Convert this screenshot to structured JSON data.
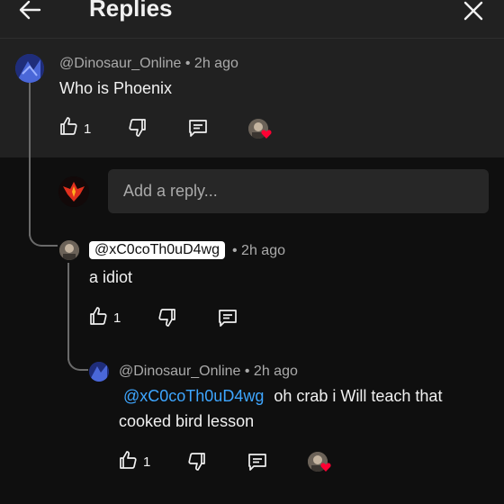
{
  "header": {
    "title": "Replies",
    "back_icon": "arrow-left-icon",
    "close_icon": "close-icon"
  },
  "parent_comment": {
    "author": "@Dinosaur_Online",
    "time": "• 2h ago",
    "text": "Who is Phoenix",
    "likes": "1"
  },
  "reply_input": {
    "placeholder": "Add a reply..."
  },
  "reply1": {
    "mention": "@xC0coTh0uD4wg",
    "time": "• 2h ago",
    "text": "a idiot",
    "likes": "1"
  },
  "reply2": {
    "author": "@Dinosaur_Online",
    "time": "• 2h ago",
    "mention": "@xC0coTh0uD4wg",
    "text_line1": "oh crab i Will teach that",
    "text_line2": "cooked bird lesson",
    "likes": "1"
  },
  "colors": {
    "background": "#0f0f0f",
    "header": "#212121",
    "link": "#3ea6ff",
    "heart": "#ff0033"
  }
}
